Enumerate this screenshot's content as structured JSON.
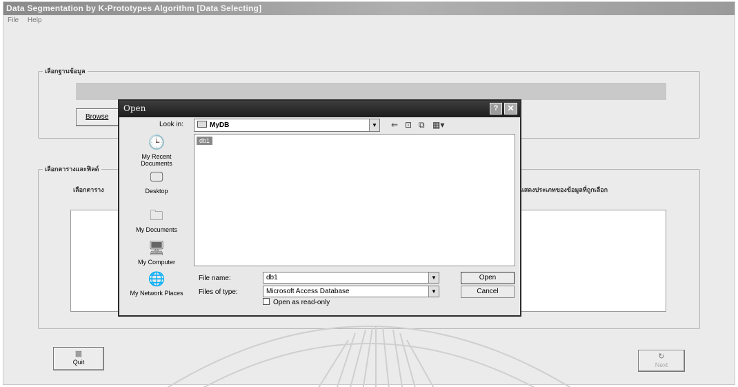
{
  "window": {
    "title": "Data Segmentation by K-Prototypes Algorithm [Data Selecting]",
    "menu": [
      "File",
      "Help"
    ]
  },
  "database_group": {
    "label": "เลือกฐานข้อมูล",
    "browse_label": "Browse"
  },
  "table_group": {
    "label": "เลือกตารางและฟิลด์",
    "table_label": "เลือกตาราง",
    "selected_fields_label": "แสดงประเภทของข้อมูลที่ถูกเลือก"
  },
  "buttons": {
    "quit_label": "Quit",
    "next_label": "Next"
  },
  "dialog": {
    "title": "Open",
    "lookin_label": "Look in:",
    "lookin_value": "MyDB",
    "places": [
      {
        "label": "My Recent Documents",
        "icon": "recent-documents-icon"
      },
      {
        "label": "Desktop",
        "icon": "desktop-icon"
      },
      {
        "label": "My Documents",
        "icon": "my-documents-icon"
      },
      {
        "label": "My Computer",
        "icon": "my-computer-icon"
      },
      {
        "label": "My Network Places",
        "icon": "network-places-icon"
      }
    ],
    "files": [
      "db1"
    ],
    "file_name_label": "File name:",
    "file_name_value": "db1",
    "file_type_label": "Files of type:",
    "file_type_value": "Microsoft Access Database",
    "readonly_label": "Open as read-only",
    "open_label": "Open",
    "cancel_label": "Cancel"
  }
}
